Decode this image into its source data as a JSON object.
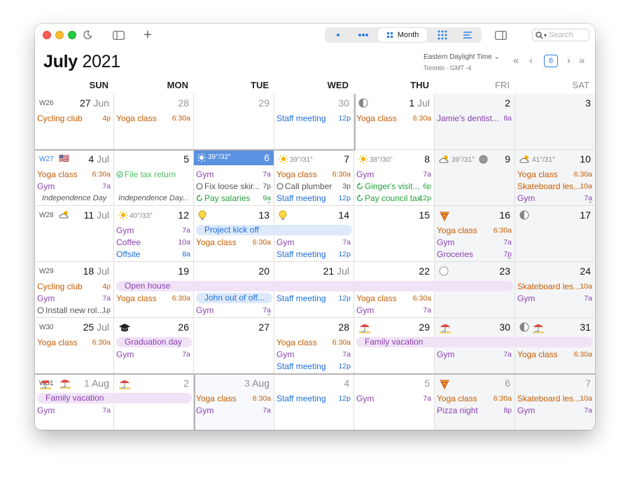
{
  "toolbar": {
    "segments": [
      "day-view",
      "week-view",
      "Month",
      "year-view",
      "list-view"
    ],
    "active_segment": "Month",
    "search_placeholder": "Search"
  },
  "header": {
    "month": "July",
    "year": "2021",
    "timezone": "Eastern Daylight Time",
    "timezone_sub": "Toronto · GMT -4",
    "today_badge": "6"
  },
  "weekdays": [
    "SUN",
    "MON",
    "TUE",
    "WED",
    "THU",
    "FRI",
    "SAT"
  ],
  "colors": {
    "orange": "#c45c00",
    "purple": "#8a3fb0",
    "blue": "#1c6fd9",
    "green": "#23a33a",
    "today": "#5b91e0",
    "bar_pink": "#f1e3f6",
    "bar_blue": "#dde9fa"
  },
  "weeks": [
    {
      "label": "W26",
      "days": [
        {
          "num": "27",
          "mon": "Jun",
          "events": [
            {
              "t": "Cycling club",
              "tm": "4p",
              "c": "orange"
            }
          ]
        },
        {
          "num": "28",
          "dim": true,
          "events": [
            {
              "t": "Yoga class",
              "tm": "6:30a",
              "c": "orange"
            }
          ]
        },
        {
          "num": "29",
          "dim": true,
          "events": []
        },
        {
          "num": "30",
          "dim": true,
          "events": [
            {
              "t": "Staff meeting",
              "tm": "12p",
              "c": "blue"
            }
          ]
        },
        {
          "num": "1",
          "mon": "Jul",
          "icon": "moon-half-icon",
          "events": [
            {
              "t": "Yoga class",
              "tm": "6:30a",
              "c": "orange"
            }
          ]
        },
        {
          "num": "2",
          "events": [
            {
              "t": "Jamie's dentist...",
              "tm": "8a",
              "c": "purple"
            }
          ]
        },
        {
          "num": "3",
          "events": []
        }
      ]
    },
    {
      "label": "W27",
      "flag": "🇺🇸",
      "days": [
        {
          "num": "4",
          "mon": "Jul",
          "note": "Independence Day",
          "events": [
            {
              "t": "Yoga class",
              "tm": "6:30a",
              "c": "orange"
            },
            {
              "t": "Gym",
              "tm": "7a",
              "c": "purple"
            }
          ]
        },
        {
          "num": "5",
          "note": "Independence Day...",
          "events": [
            {
              "t": "File tax return",
              "tm": "",
              "c": "lightgreen",
              "check": "done"
            }
          ]
        },
        {
          "num": "6",
          "today": true,
          "weather": "39°/32°",
          "events": [
            {
              "t": "Gym",
              "tm": "7a",
              "c": "purple"
            },
            {
              "t": "Fix loose skir...",
              "tm": "7p",
              "c": "gray",
              "check": "todo"
            },
            {
              "t": "Pay salaries",
              "tm": "9a",
              "c": "green",
              "check": "repeat"
            }
          ]
        },
        {
          "num": "7",
          "weather": "39°/31°",
          "events": [
            {
              "t": "Yoga class",
              "tm": "6:30a",
              "c": "orange"
            },
            {
              "t": "Call plumber",
              "tm": "3p",
              "c": "gray",
              "check": "todo"
            },
            {
              "t": "Staff meeting",
              "tm": "12p",
              "c": "blue"
            }
          ]
        },
        {
          "num": "8",
          "weather": "38°/30°",
          "events": [
            {
              "t": "Gym",
              "tm": "7a",
              "c": "purple"
            },
            {
              "t": "Ginger's visit...",
              "tm": "6p",
              "c": "green",
              "check": "repeat"
            },
            {
              "t": "Pay council tax",
              "tm": "12p",
              "c": "green",
              "check": "repeat"
            }
          ]
        },
        {
          "num": "9",
          "weather": "39°/31°",
          "events": []
        },
        {
          "num": "10",
          "weather": "41°/31°",
          "events": [
            {
              "t": "Yoga class",
              "tm": "6:30a",
              "c": "orange"
            },
            {
              "t": "Skateboard les...",
              "tm": "10a",
              "c": "orange"
            },
            {
              "t": "Gym",
              "tm": "7a",
              "c": "purple"
            }
          ]
        }
      ]
    },
    {
      "label": "W28",
      "days": [
        {
          "num": "11",
          "mon": "Jul",
          "events": []
        },
        {
          "num": "12",
          "weather": "40°/33°",
          "events": [
            {
              "t": "Gym",
              "tm": "7a",
              "c": "purple"
            },
            {
              "t": "Coffee",
              "tm": "10a",
              "c": "purple"
            },
            {
              "t": "Offsite",
              "tm": "8a",
              "c": "blue"
            }
          ]
        },
        {
          "num": "13",
          "icon": "lightbulb-icon",
          "events": [
            {
              "t": "",
              "tm": "",
              "c": "blue"
            },
            {
              "t": "Yoga class",
              "tm": "6:30a",
              "c": "orange"
            }
          ]
        },
        {
          "num": "14",
          "icon": "lightbulb-icon",
          "events": [
            {
              "t": "",
              "tm": "",
              "c": "blue"
            },
            {
              "t": "Gym",
              "tm": "7a",
              "c": "purple"
            },
            {
              "t": "Staff meeting",
              "tm": "12p",
              "c": "blue"
            }
          ]
        },
        {
          "num": "15",
          "events": []
        },
        {
          "num": "16",
          "icon": "pizza-icon",
          "events": [
            {
              "t": "Yoga class",
              "tm": "6:30a",
              "c": "orange"
            },
            {
              "t": "Gym",
              "tm": "7a",
              "c": "purple"
            },
            {
              "t": "Groceries",
              "tm": "7p",
              "c": "purple"
            }
          ]
        },
        {
          "num": "17",
          "icon": "moon-half-icon",
          "events": []
        }
      ],
      "bars": [
        {
          "label": "Project kick off",
          "style": "lblue",
          "from": 2,
          "to": 3
        }
      ]
    },
    {
      "label": "W29",
      "days": [
        {
          "num": "18",
          "mon": "Jul",
          "events": [
            {
              "t": "Cycling club",
              "tm": "4p",
              "c": "orange"
            },
            {
              "t": "Gym",
              "tm": "7a",
              "c": "purple"
            },
            {
              "t": "Install new rol...",
              "tm": "1p",
              "c": "gray",
              "check": "todo"
            }
          ]
        },
        {
          "num": "19",
          "events": [
            {
              "t": "",
              "tm": "",
              "c": ""
            },
            {
              "t": "Yoga class",
              "tm": "6:30a",
              "c": "orange"
            }
          ]
        },
        {
          "num": "20",
          "events": [
            {
              "t": "",
              "tm": "",
              "c": ""
            },
            {
              "t": "",
              "tm": "",
              "c": ""
            },
            {
              "t": "Gym",
              "tm": "7a",
              "c": "purple"
            }
          ]
        },
        {
          "num": "21",
          "mon": "Jul",
          "events": [
            {
              "t": "",
              "tm": "",
              "c": ""
            },
            {
              "t": "Staff meeting",
              "tm": "12p",
              "c": "blue"
            }
          ]
        },
        {
          "num": "22",
          "events": [
            {
              "t": "",
              "tm": "",
              "c": ""
            },
            {
              "t": "Yoga class",
              "tm": "6:30a",
              "c": "orange"
            },
            {
              "t": "Gym",
              "tm": "7a",
              "c": "purple"
            }
          ]
        },
        {
          "num": "23",
          "icon": "moon-full-icon",
          "events": []
        },
        {
          "num": "24",
          "events": [
            {
              "t": "Skateboard les...",
              "tm": "10a",
              "c": "orange"
            },
            {
              "t": "Gym",
              "tm": "7a",
              "c": "purple"
            }
          ]
        }
      ],
      "bars": [
        {
          "label": "Open house",
          "style": "pink",
          "from": 1,
          "to": 5
        },
        {
          "label": "John out of off...",
          "style": "lblue",
          "from": 2,
          "to": 2
        }
      ]
    },
    {
      "label": "W30",
      "days": [
        {
          "num": "25",
          "mon": "Jul",
          "events": [
            {
              "t": "Yoga class",
              "tm": "6:30a",
              "c": "orange"
            }
          ]
        },
        {
          "num": "26",
          "icon": "graduation-cap-icon",
          "events": [
            {
              "t": "",
              "tm": "",
              "c": ""
            },
            {
              "t": "Gym",
              "tm": "7a",
              "c": "purple"
            }
          ]
        },
        {
          "num": "27",
          "events": []
        },
        {
          "num": "28",
          "events": [
            {
              "t": "Yoga class",
              "tm": "6:30a",
              "c": "orange"
            },
            {
              "t": "Gym",
              "tm": "7a",
              "c": "purple"
            },
            {
              "t": "Staff meeting",
              "tm": "12p",
              "c": "blue"
            }
          ]
        },
        {
          "num": "29",
          "icon": "beach-icon",
          "events": []
        },
        {
          "num": "30",
          "icon": "beach-icon",
          "events": [
            {
              "t": "",
              "tm": "",
              "c": ""
            },
            {
              "t": "Gym",
              "tm": "7a",
              "c": "purple"
            }
          ]
        },
        {
          "num": "31",
          "icon": "moon-half-icon",
          "icon2": "beach-icon",
          "events": [
            {
              "t": "",
              "tm": "",
              "c": ""
            },
            {
              "t": "Yoga class",
              "tm": "6:30a",
              "c": "orange"
            }
          ]
        }
      ],
      "bars": [
        {
          "label": "Graduation day",
          "style": "pink",
          "from": 1,
          "to": 1
        },
        {
          "label": "Family vacation",
          "style": "pink",
          "from": 4,
          "to": 6
        }
      ]
    },
    {
      "label": "W31",
      "days": [
        {
          "num": "1",
          "mon": "Aug",
          "dim": true,
          "icon": "beach-icon",
          "events": [
            {
              "t": "",
              "tm": "",
              "c": ""
            },
            {
              "t": "Gym",
              "tm": "7a",
              "c": "purple"
            }
          ]
        },
        {
          "num": "2",
          "dim": true,
          "icon": "beach-icon",
          "events": []
        },
        {
          "num": "3",
          "mon": "Aug",
          "dim": true,
          "events": [
            {
              "t": "Yoga class",
              "tm": "6:30a",
              "c": "orange"
            },
            {
              "t": "Gym",
              "tm": "7a",
              "c": "purple"
            }
          ]
        },
        {
          "num": "4",
          "dim": true,
          "events": [
            {
              "t": "Staff meeting",
              "tm": "12p",
              "c": "blue"
            }
          ]
        },
        {
          "num": "5",
          "dim": true,
          "events": [
            {
              "t": "Gym",
              "tm": "7a",
              "c": "purple"
            }
          ]
        },
        {
          "num": "6",
          "dim": true,
          "icon": "pizza-icon",
          "events": [
            {
              "t": "Yoga class",
              "tm": "6:30a",
              "c": "orange"
            },
            {
              "t": "Pizza night",
              "tm": "8p",
              "c": "purple"
            }
          ]
        },
        {
          "num": "7",
          "dim": true,
          "events": [
            {
              "t": "Skateboard les...",
              "tm": "10a",
              "c": "orange"
            },
            {
              "t": "Gym",
              "tm": "7a",
              "c": "purple"
            }
          ]
        }
      ],
      "bars": [
        {
          "label": "Family vacation",
          "style": "pink",
          "from": 0,
          "to": 1
        }
      ]
    }
  ]
}
